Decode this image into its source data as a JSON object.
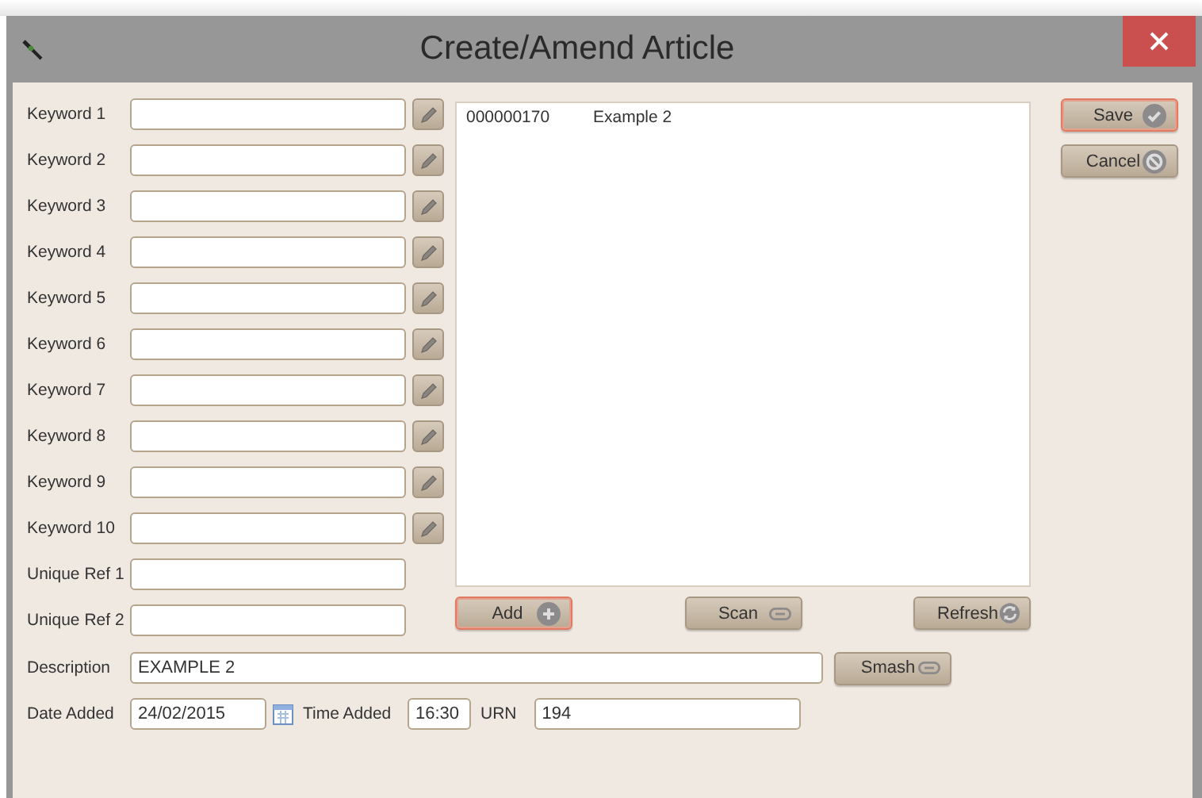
{
  "window": {
    "title": "Create/Amend Article"
  },
  "keywords": [
    {
      "label": "Keyword 1"
    },
    {
      "label": "Keyword 2"
    },
    {
      "label": "Keyword 3"
    },
    {
      "label": "Keyword 4"
    },
    {
      "label": "Keyword 5"
    },
    {
      "label": "Keyword 6"
    },
    {
      "label": "Keyword 7"
    },
    {
      "label": "Keyword 8"
    },
    {
      "label": "Keyword 9"
    },
    {
      "label": "Keyword 10"
    }
  ],
  "unique_refs": [
    {
      "label": "Unique Ref 1"
    },
    {
      "label": "Unique Ref 2"
    }
  ],
  "list_items": [
    {
      "column_1": "000000170",
      "column_2": "Example 2"
    }
  ],
  "side_buttons": [
    {
      "label": "Save",
      "kind": "confirm",
      "highlighted": true
    },
    {
      "label": "Cancel",
      "kind": "cancel",
      "highlighted": false
    }
  ],
  "list_buttons": [
    {
      "label": "Add",
      "kind": "add",
      "highlighted": true
    },
    {
      "label": "Scan",
      "kind": "link",
      "highlighted": false
    },
    {
      "label": "Refresh",
      "kind": "refresh",
      "highlighted": false
    }
  ],
  "description": {
    "label": "Description",
    "value": "EXAMPLE 2"
  },
  "smash_button": {
    "label": "Smash",
    "kind": "link",
    "highlighted": false
  },
  "date_added": {
    "label": "Date Added",
    "value": "24/02/2015"
  },
  "time_added": {
    "label": "Time Added",
    "value": "16:30"
  },
  "urn": {
    "label": "URN",
    "value": "194"
  }
}
